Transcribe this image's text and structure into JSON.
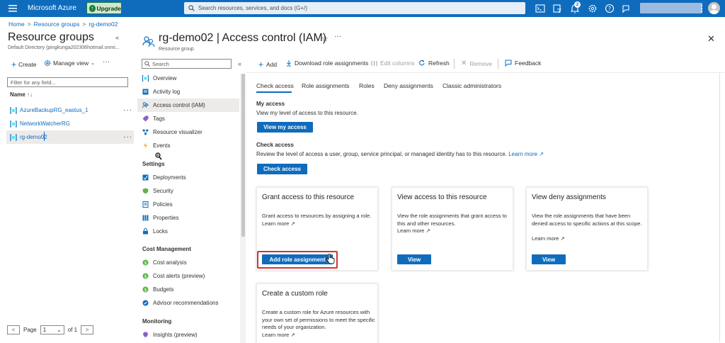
{
  "topbar": {
    "brand": "Microsoft Azure",
    "upgrade_label": "Upgrade",
    "search_placeholder": "Search resources, services, and docs (G+/)",
    "notification_count": "2",
    "icons": [
      "cloud-shell-icon",
      "directory-filter-icon",
      "bell-icon",
      "gear-icon",
      "help-icon",
      "feedback-icon"
    ]
  },
  "breadcrumb": [
    "Home",
    "Resource groups",
    "rg-demo02"
  ],
  "left_pane": {
    "title": "Resource groups",
    "subtitle": "Default Directory (pingkunga202306hotmail.onmi...",
    "create_label": "Create",
    "manage_view_label": "Manage view",
    "filter_placeholder": "Filter for any field...",
    "name_header": "Name",
    "rows": [
      {
        "name": "AzureBackupRG_eastus_1"
      },
      {
        "name": "NetworkWatcherRG"
      },
      {
        "name": "rg-demo02"
      }
    ],
    "pager": {
      "page_label": "Page",
      "current": "1",
      "of_label": "of 1"
    }
  },
  "resource": {
    "title": "rg-demo02 | Access control (IAM)",
    "subtitle": "Resource group"
  },
  "nav": {
    "search_placeholder": "Search",
    "items": [
      {
        "label": "Overview",
        "icon": "overview-icon"
      },
      {
        "label": "Activity log",
        "icon": "activity-log-icon"
      },
      {
        "label": "Access control (IAM)",
        "icon": "people-icon"
      },
      {
        "label": "Tags",
        "icon": "tag-icon"
      },
      {
        "label": "Resource visualizer",
        "icon": "visualizer-icon"
      },
      {
        "label": "Events",
        "icon": "events-icon"
      }
    ],
    "settings_header": "Settings",
    "settings_items": [
      {
        "label": "Deployments",
        "icon": "deployments-icon"
      },
      {
        "label": "Security",
        "icon": "shield-icon"
      },
      {
        "label": "Policies",
        "icon": "policy-icon"
      },
      {
        "label": "Properties",
        "icon": "properties-icon"
      },
      {
        "label": "Locks",
        "icon": "lock-icon"
      }
    ],
    "cost_header": "Cost Management",
    "cost_items": [
      {
        "label": "Cost analysis",
        "icon": "cost-analysis-icon"
      },
      {
        "label": "Cost alerts (preview)",
        "icon": "cost-alerts-icon"
      },
      {
        "label": "Budgets",
        "icon": "budgets-icon"
      },
      {
        "label": "Advisor recommendations",
        "icon": "advisor-icon"
      }
    ],
    "monitoring_header": "Monitoring",
    "monitoring_items": [
      {
        "label": "Insights (preview)",
        "icon": "insights-icon"
      }
    ]
  },
  "toolbar": {
    "add": "Add",
    "download": "Download role assignments",
    "edit_columns": "Edit columns",
    "refresh": "Refresh",
    "remove": "Remove",
    "feedback": "Feedback"
  },
  "tabs": [
    "Check access",
    "Role assignments",
    "Roles",
    "Deny assignments",
    "Classic administrators"
  ],
  "content": {
    "my_access_title": "My access",
    "my_access_text": "View my level of access to this resource.",
    "view_my_access_btn": "View my access",
    "check_access_title": "Check access",
    "check_access_text": "Review the level of access a user, group, service principal, or managed identity has to this resource.",
    "learn_more": "Learn more",
    "check_access_btn": "Check access",
    "cards": {
      "grant": {
        "title": "Grant access to this resource",
        "text": "Grant access to resources by assigning a role.",
        "link": "Learn more",
        "button": "Add role assignment"
      },
      "view": {
        "title": "View access to this resource",
        "text": "View the role assignments that grant access to this and other resources.",
        "link": "Learn more",
        "button": "View"
      },
      "deny": {
        "title": "View deny assignments",
        "text": "View the role assignments that have been denied access to specific actions at this scope.",
        "link": "Learn more",
        "button": "View"
      },
      "custom": {
        "title": "Create a custom role",
        "text": "Create a custom role for Azure resources with your own set of permissions to meet the specific needs of your organization.",
        "link": "Learn more"
      }
    }
  },
  "colors": {
    "accent": "#0f6cbd",
    "highlight": "#d13438"
  }
}
